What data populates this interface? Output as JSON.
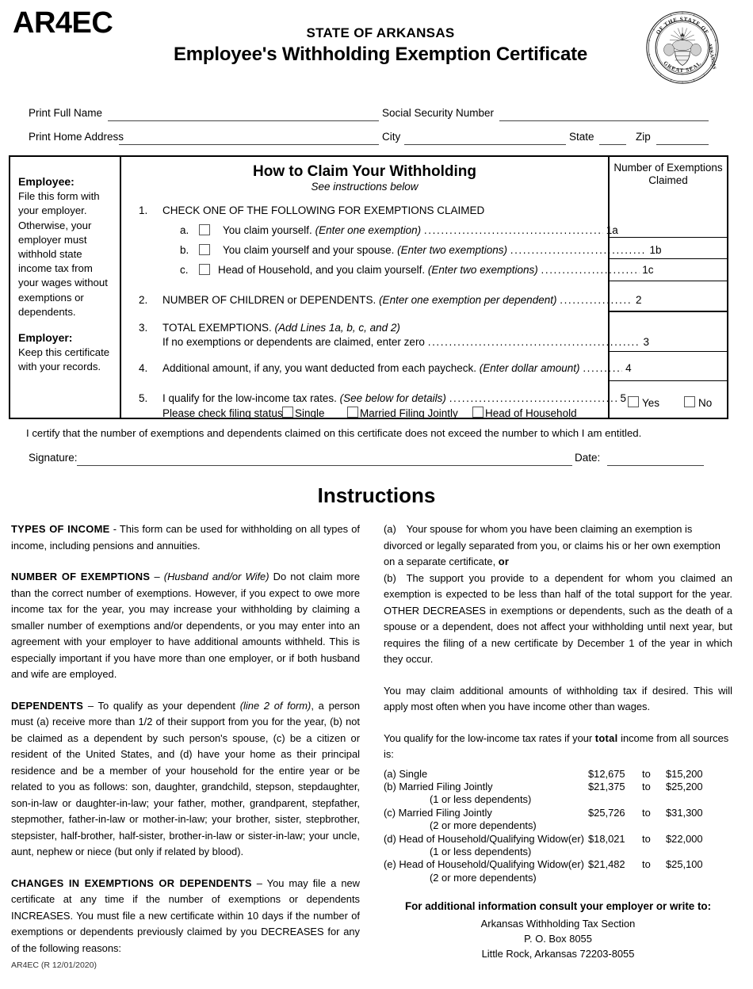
{
  "header": {
    "form_code": "AR4EC",
    "state_line": "STATE OF ARKANSAS",
    "title": "Employee's Withholding Exemption Certificate",
    "seal_text": "GREAT SEAL OF THE STATE OF ARKANSAS"
  },
  "id_fields": {
    "full_name_label": "Print Full Name",
    "full_name_value": "",
    "ssn_label": "Social Security Number",
    "ssn_value": "",
    "address_label": "Print Home Address",
    "address_value": "",
    "city_label": "City",
    "city_value": "",
    "state_label": "State",
    "state_value": "",
    "zip_label": "Zip",
    "zip_value": ""
  },
  "table": {
    "employee_heading": "Employee:",
    "employee_text": "File this form with your employer. Otherwise, your employer must withhold state income tax from your wages without exemptions or dependents.",
    "employer_heading": "Employer:",
    "employer_text": "Keep this certificate with your records.",
    "how_title": "How to Claim Your Withholding",
    "how_subtitle": "See instructions below",
    "exempt_col_header_1": "Number of Exemptions",
    "exempt_col_header_2": "Claimed",
    "line1_num": "1.",
    "line1_text": "CHECK ONE OF THE FOLLOWING FOR EXEMPTIONS CLAIMED",
    "line1a_letter": "a.",
    "line1a_text": "You claim yourself.",
    "line1a_italic": "(Enter one exemption)",
    "line1a_ref": "1a",
    "line1a_value": "",
    "line1b_letter": "b.",
    "line1b_text": "You claim yourself and your spouse.",
    "line1b_italic": "(Enter two exemptions)",
    "line1b_ref": "1b",
    "line1b_value": "",
    "line1c_letter": "c.",
    "line1c_text": "Head of Household, and you claim yourself.",
    "line1c_italic": "(Enter two exemptions)",
    "line1c_ref": "1c",
    "line1c_value": "",
    "line2_num": "2.",
    "line2_text": "NUMBER OF CHILDREN or DEPENDENTS.",
    "line2_italic": "(Enter one exemption per dependent)",
    "line2_ref": "2",
    "line2_value": "",
    "line3_num": "3.",
    "line3_text": "TOTAL EXEMPTIONS.",
    "line3_italic": "(Add Lines 1a, b, c, and 2)",
    "line3_text2": "If no exemptions or dependents are claimed, enter zero",
    "line3_ref": "3",
    "line3_value": "",
    "line4_num": "4.",
    "line4_text": "Additional amount, if any, you want deducted from each paycheck.",
    "line4_italic": "(Enter dollar amount)",
    "line4_ref": "4",
    "line4_value": "",
    "line5_num": "5.",
    "line5_text": "I qualify for the low-income tax rates.",
    "line5_italic": "(See below for details)",
    "line5_ref": "5",
    "line5_yes": "Yes",
    "line5_no": "No",
    "filing_status_label": "Please check filing status:",
    "filing_single": "Single",
    "filing_mfj": "Married Filing Jointly",
    "filing_hoh": "Head of Household"
  },
  "certification": {
    "text": "I certify that the number of exemptions and dependents claimed on this certificate does not exceed the number to which I am entitled.",
    "signature_label": "Signature:",
    "signature_value": "",
    "date_label": "Date:",
    "date_value": ""
  },
  "instructions": {
    "title": "Instructions",
    "left": [
      {
        "heading": "TYPES OF INCOME",
        "body": " - This form can be used for withholding on all types of income, including pensions and annuities."
      },
      {
        "heading": "NUMBER OF EXEMPTIONS",
        "body_pre": " – ",
        "body_italic": "(Husband and/or Wife)",
        "body": " Do not claim more than the correct number of exemptions. However, if you expect to owe more income tax for the year, you may increase your withholding by claiming a smaller number of exemptions and/or dependents, or you may enter into an agreement with your employer to have additional amounts withheld. This is especially important if you have more than one employer, or if both husband and wife are employed."
      },
      {
        "heading": "DEPENDENTS",
        "body_pre": " – To qualify as your dependent ",
        "body_italic": "(line 2 of form)",
        "body": ", a person must (a) receive more than 1/2 of their support from you for the year, (b) not be claimed as a dependent by such person's spouse, (c) be a citizen or resident of the United States, and (d) have your home as their principal residence and be a member of your household for the entire year or be related to you as follows: son, daughter, grandchild, stepson, stepdaughter, son-in-law or daughter-in-law; your father, mother, grandparent, stepfather, stepmother, father-in-law or mother-in-law; your brother, sister, stepbrother, stepsister, half-brother, half-sister, brother-in-law or sister-in-law; your uncle, aunt, nephew or niece (but only if related by blood)."
      },
      {
        "heading": "CHANGES IN EXEMPTIONS OR DEPENDENTS",
        "body": " – You may file a new certificate at any time if the number of exemptions or dependents INCREASES. You must file a new certificate within 10 days if the number of exemptions or dependents previously claimed by you DECREASES for any of the following reasons:"
      }
    ],
    "right": {
      "item_a": "(a) Your spouse for whom you have been claiming an exemption is divorced or legally separated from you, or claims his or her own exemption on a separate certificate, ",
      "item_a_bold": "or",
      "item_b": "(b) The support you provide to a dependent for whom you claimed an exemption is expected to be less than half of the total support for the year. OTHER DECREASES in exemptions or dependents, such as the death of a spouse or a dependent, does not affect your withholding until next year, but requires the filing of a new certificate by December 1 of the year in which they occur.",
      "para_additional": "You may claim additional amounts of withholding tax if desired. This will apply most often when you have income other than wages.",
      "qualify_pre": "You qualify for the low-income tax rates if your ",
      "qualify_bold": "total",
      "qualify_post": " income from all sources is:",
      "brackets": [
        {
          "label": "(a)  Single",
          "sub": "",
          "min": "$12,675",
          "to": "to",
          "max": "$15,200"
        },
        {
          "label": "(b) Married Filing Jointly",
          "sub": "(1 or less dependents)",
          "min": "$21,375",
          "to": "to",
          "max": "$25,200"
        },
        {
          "label": "(c)  Married Filing Jointly",
          "sub": "(2 or more dependents)",
          "min": "$25,726",
          "to": "to",
          "max": "$31,300"
        },
        {
          "label": "(d) Head of Household/Qualifying Widow(er)",
          "sub": "(1 or less dependents)",
          "min": "$18,021",
          "to": "to",
          "max": "$22,000"
        },
        {
          "label": "(e) Head of Household/Qualifying Widow(er)",
          "sub": "(2 or more dependents)",
          "min": "$21,482",
          "to": "to",
          "max": "$25,100"
        }
      ],
      "contact_heading": "For additional information consult your employer or write to:",
      "contact_line1": "Arkansas Withholding Tax Section",
      "contact_line2": "P. O. Box 8055",
      "contact_line3": "Little Rock, Arkansas  72203-8055"
    }
  },
  "footer": {
    "revision": "AR4EC (R 12/01/2020)"
  }
}
